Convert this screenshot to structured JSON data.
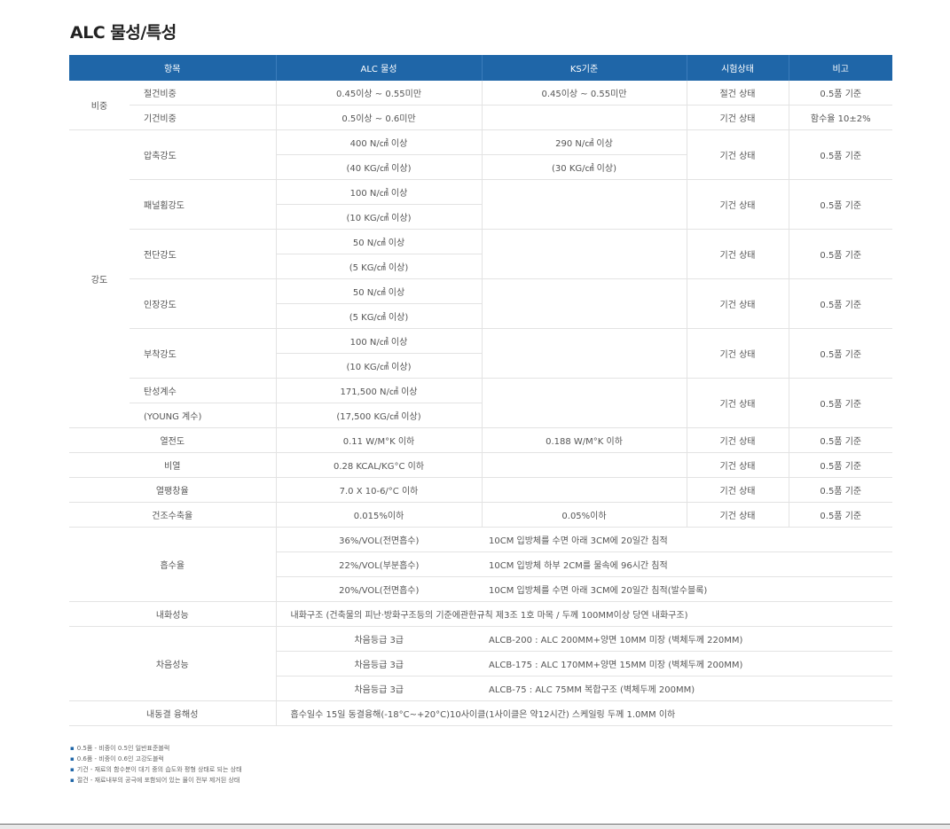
{
  "title": "ALC 물성/특성",
  "headers": [
    "항목",
    "ALC 물성",
    "KS기준",
    "시험상태",
    "비고"
  ],
  "rows": {
    "bizhong": {
      "label": "비중",
      "dry": {
        "name": "절건비중",
        "alc": "0.45이상 ~ 0.55미만",
        "ks": "0.45이상 ~ 0.55미만",
        "state": "절건 상태",
        "note": "0.5품 기준"
      },
      "air": {
        "name": "기건비중",
        "alc": "0.5이상 ~ 0.6미만",
        "state": "기건 상태",
        "note": "함수율 10±2%"
      }
    },
    "strength": {
      "label": "강도",
      "compress": {
        "name": "압축강도",
        "alc1": "400 N/㎠ 이상",
        "alc2": "(40 KG/㎠ 이상)",
        "ks1": "290 N/㎠ 이상",
        "ks2": "(30 KG/㎠ 이상)",
        "state": "기건 상태",
        "note": "0.5품 기준"
      },
      "bend": {
        "name": "패널휨강도",
        "alc1": "100 N/㎠ 이상",
        "alc2": "(10 KG/㎠ 이상)",
        "state": "기건 상태",
        "note": "0.5품 기준"
      },
      "shear": {
        "name": "전단강도",
        "alc1": "50 N/㎠ 이상",
        "alc2": "(5 KG/㎠ 이상)",
        "state": "기건 상태",
        "note": "0.5품 기준"
      },
      "tensile": {
        "name": "인장강도",
        "alc1": "50 N/㎠ 이상",
        "alc2": "(5 KG/㎠ 이상)",
        "state": "기건 상태",
        "note": "0.5품 기준"
      },
      "adhesion": {
        "name": "부착강도",
        "alc1": "100 N/㎠ 이상",
        "alc2": "(10 KG/㎠ 이상)",
        "state": "기건 상태",
        "note": "0.5품 기준"
      },
      "young": {
        "name1": "탄성계수",
        "name2": "(YOUNG 계수)",
        "alc1": "171,500 N/㎠ 이상",
        "alc2": "(17,500 KG/㎠ 이상)",
        "state": "기건 상태",
        "note": "0.5품 기준"
      }
    },
    "conduct": {
      "label": "열전도",
      "alc": "0.11 W/M°K 이하",
      "ks": "0.188 W/M°K 이하",
      "state": "기건 상태",
      "note": "0.5품 기준"
    },
    "specheat": {
      "label": "비열",
      "alc": "0.28 KCAL/KG°C 이하",
      "state": "기건 상태",
      "note": "0.5품 기준"
    },
    "expand": {
      "label": "열팽창율",
      "alc": "7.0 X 10-6/°C 이하",
      "state": "기건 상태",
      "note": "0.5품 기준"
    },
    "shrink": {
      "label": "건조수축율",
      "alc": "0.015%이하",
      "ks": "0.05%이하",
      "state": "기건 상태",
      "note": "0.5품 기준"
    },
    "absorb": {
      "label": "흡수율",
      "r1": {
        "alc": "36%/VOL(전면흡수)",
        "desc": "10CM 입방체를 수면 아래 3CM에 20일간 침적"
      },
      "r2": {
        "alc": "22%/VOL(부분흡수)",
        "desc": "10CM 입방체 하부 2CM를 물속에 96시간 침적"
      },
      "r3": {
        "alc": "20%/VOL(전면흡수)",
        "desc": "10CM 입방체를 수면 아래 3CM에 20일간 침적(발수블록)"
      }
    },
    "fire": {
      "label": "내화성능",
      "desc": "내화구조 (건축물의 피난·방화구조등의 기준에관한규칙 제3조 1호 마목 / 두께 100MM이상 당연 내화구조)"
    },
    "sound": {
      "label": "차음성능",
      "r1": {
        "grade": "차음등급 3급",
        "desc": "ALCB-200 : ALC 200MM+양면 10MM 미장 (벽체두께 220MM)"
      },
      "r2": {
        "grade": "차음등급 3급",
        "desc": "ALCB-175 : ALC 170MM+양면 15MM 미장 (벽체두께 200MM)"
      },
      "r3": {
        "grade": "차음등급 3급",
        "desc": "ALCB-75 : ALC 75MM 복합구조 (벽체두께 200MM)"
      }
    },
    "freeze": {
      "label": "내동결 융해성",
      "desc": "흡수일수 15일 동결융해(-18°C~+20°C)10사이클(1사이클은 약12시간) 스케일링 두께 1.0MM 이하"
    }
  },
  "notes": [
    "0.5품 - 비중이 0.5인 일반표준블럭",
    "0.6품 - 비중이 0.6인 고강도블럭",
    "기건 - 재료의 함수분이 대기 중의 습도와 평형 상태로 되는 상태",
    "절건 - 재료내부의 공극에 포함되어 있는 물이 전부 제거된 상태"
  ],
  "bullet": "▪",
  "colors": {
    "header_bg": "#1f66a8",
    "header_text": "#ffffff",
    "border": "#e3e3e3",
    "text": "#555555"
  }
}
